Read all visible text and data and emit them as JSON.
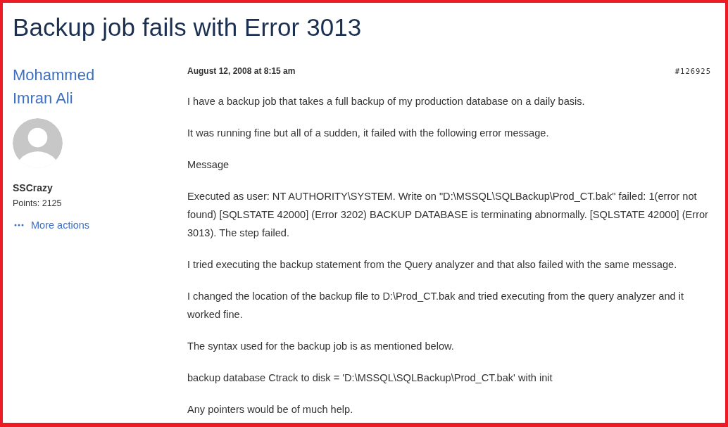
{
  "topic": {
    "title": "Backup job fails with Error 3013"
  },
  "post": {
    "author": {
      "name": "Mohammed Imran Ali",
      "rank": "SSCrazy",
      "points": "Points: 2125",
      "more_actions": "More actions"
    },
    "date": "August 12, 2008 at 8:15 am",
    "post_number": "#126925",
    "paragraphs": [
      "I have a backup job that takes a full backup of my production database on a daily basis.",
      "It was running fine but all of a sudden, it failed with the following error message.",
      "Message",
      "Executed as user: NT AUTHORITY\\SYSTEM. Write on \"D:\\MSSQL\\SQLBackup\\Prod_CT.bak\" failed: 1(error not found) [SQLSTATE 42000] (Error 3202) BACKUP DATABASE is terminating abnormally. [SQLSTATE 42000] (Error 3013). The step failed.",
      "I tried executing the backup statement from the Query analyzer and that also failed with the same message.",
      "I changed the location of the backup file to D:\\Prod_CT.bak and tried executing from the query analyzer and it worked fine.",
      "The syntax used for the backup job is as mentioned below.",
      "backup database Ctrack to disk = 'D:\\MSSQL\\SQLBackup\\Prod_CT.bak' with init",
      "Any pointers would be of much help."
    ]
  }
}
